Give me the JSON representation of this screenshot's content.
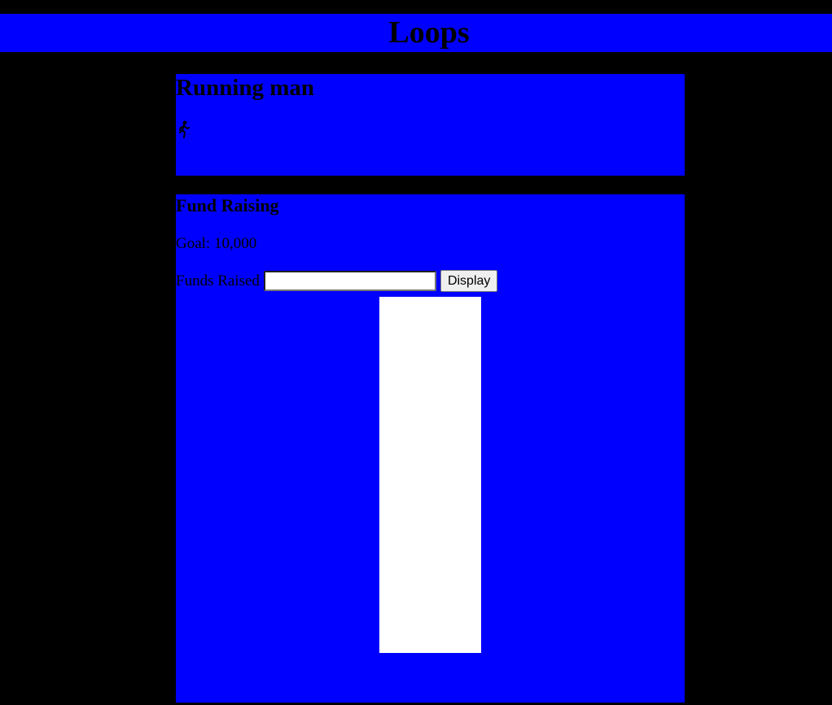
{
  "page": {
    "title": "Loops"
  },
  "running_man": {
    "heading": "Running man",
    "icon": "running-man-icon"
  },
  "fund_raising": {
    "heading": "Fund Raising",
    "goal_text": "Goal: 10,000",
    "funds_label": "Funds Raised",
    "funds_value": "",
    "funds_placeholder": "",
    "display_button": "Display",
    "progress_fraction": 0
  },
  "colors": {
    "background": "#000000",
    "panel": "#0000ff",
    "thermometer": "#ffffff"
  }
}
